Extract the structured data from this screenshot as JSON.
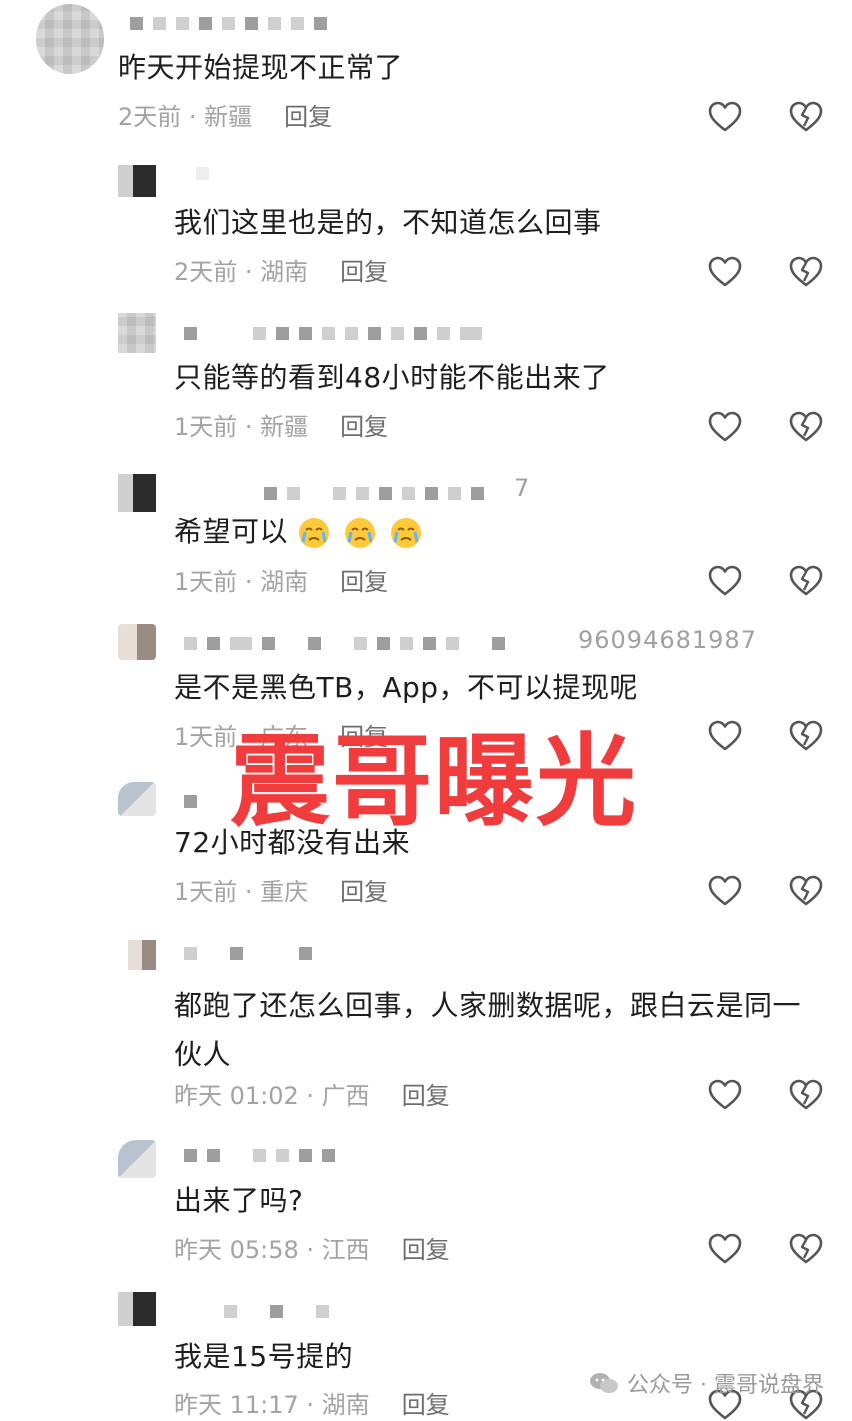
{
  "overlay_title": "震哥曝光",
  "watermark": {
    "label": "公众号 · 震哥说盘界"
  },
  "comments": [
    {
      "text": "昨天开始提现不正常了",
      "time": "2天前 · 新疆",
      "reply": "回复"
    },
    {
      "text": "我们这里也是的，不知道怎么回事",
      "time": "2天前 · 湖南",
      "reply": "回复"
    },
    {
      "text": "只能等的看到48小时能不能出来了",
      "time": "1天前 · 新疆",
      "reply": "回复"
    },
    {
      "text": "希望可以",
      "time": "1天前 · 湖南",
      "reply": "回复",
      "name_suffix": "7"
    },
    {
      "text": "是不是黑色TB，App，不可以提现呢",
      "time": "1天前 · 广东",
      "reply": "回复",
      "name_suffix": "96094681987"
    },
    {
      "text": "72小时都没有出来",
      "time": "1天前 · 重庆",
      "reply": "回复"
    },
    {
      "text": "都跑了还怎么回事，人家删数据呢，跟白云是同一伙人",
      "time": "昨天 01:02 · 广西",
      "reply": "回复"
    },
    {
      "text": "出来了吗?",
      "time": "昨天 05:58 · 江西",
      "reply": "回复"
    },
    {
      "text": "我是15号提的",
      "time": "昨天 11:17 · 湖南",
      "reply": "回复"
    }
  ]
}
